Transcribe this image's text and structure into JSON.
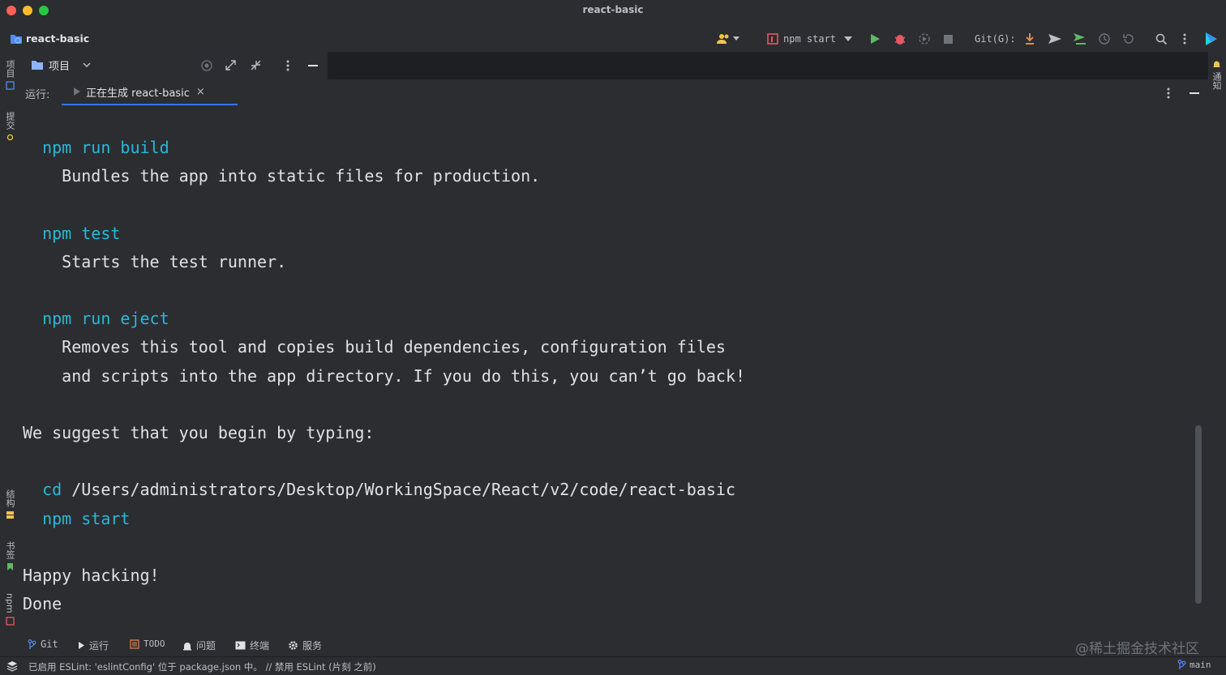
{
  "window": {
    "title": "react-basic"
  },
  "toolbar": {
    "project": "react-basic",
    "run_config": "npm start",
    "git_label": "Git(G):"
  },
  "project_panel": {
    "title": "项目"
  },
  "left_strip": {
    "project": "项目",
    "commit": "提交",
    "structure": "结构",
    "bookmarks": "书签",
    "npm": "npm"
  },
  "right_strip": {
    "notifications": "通知"
  },
  "run_panel": {
    "label": "运行:",
    "tab": "正在生成 react-basic",
    "tab_close": "×"
  },
  "console": {
    "lines": [
      {
        "text": "  npm run build",
        "color": "cyan"
      },
      {
        "text": "    Bundles the app into static files for production.",
        "color": "default"
      },
      {
        "text": "",
        "color": "default"
      },
      {
        "text": "  npm test",
        "color": "cyan"
      },
      {
        "text": "    Starts the test runner.",
        "color": "default"
      },
      {
        "text": "",
        "color": "default"
      },
      {
        "text": "  npm run eject",
        "color": "cyan"
      },
      {
        "text": "    Removes this tool and copies build dependencies, configuration files",
        "color": "default"
      },
      {
        "text": "    and scripts into the app directory. If you do this, you can’t go back!",
        "color": "default"
      },
      {
        "text": "",
        "color": "default"
      },
      {
        "text": "We suggest that you begin by typing:",
        "color": "default"
      },
      {
        "text": "",
        "color": "default"
      },
      {
        "text": "  cd",
        "color": "cyan",
        "rest": " /Users/administrators/Desktop/WorkingSpace/React/v2/code/react-basic"
      },
      {
        "text": "  npm start",
        "color": "cyan"
      },
      {
        "text": "",
        "color": "default"
      },
      {
        "text": "Happy hacking!",
        "color": "default"
      },
      {
        "text": "Done",
        "color": "default"
      }
    ]
  },
  "bottom_tools": {
    "git": "Git",
    "run": "运行",
    "todo": "TODO",
    "problems": "问题",
    "terminal": "终端",
    "services": "服务"
  },
  "status_bar": {
    "message": "已启用 ESLint: 'eslintConfig' 位于 package.json 中。 // 禁用 ESLint (片刻 之前)",
    "branch": "main"
  },
  "watermark": "@稀土掘金技术社区",
  "colors": {
    "accent": "#3574f0",
    "cyan": "#29b8db",
    "run_green": "#5fb865",
    "debug_red": "#e55765",
    "git_orange": "#e08855"
  }
}
